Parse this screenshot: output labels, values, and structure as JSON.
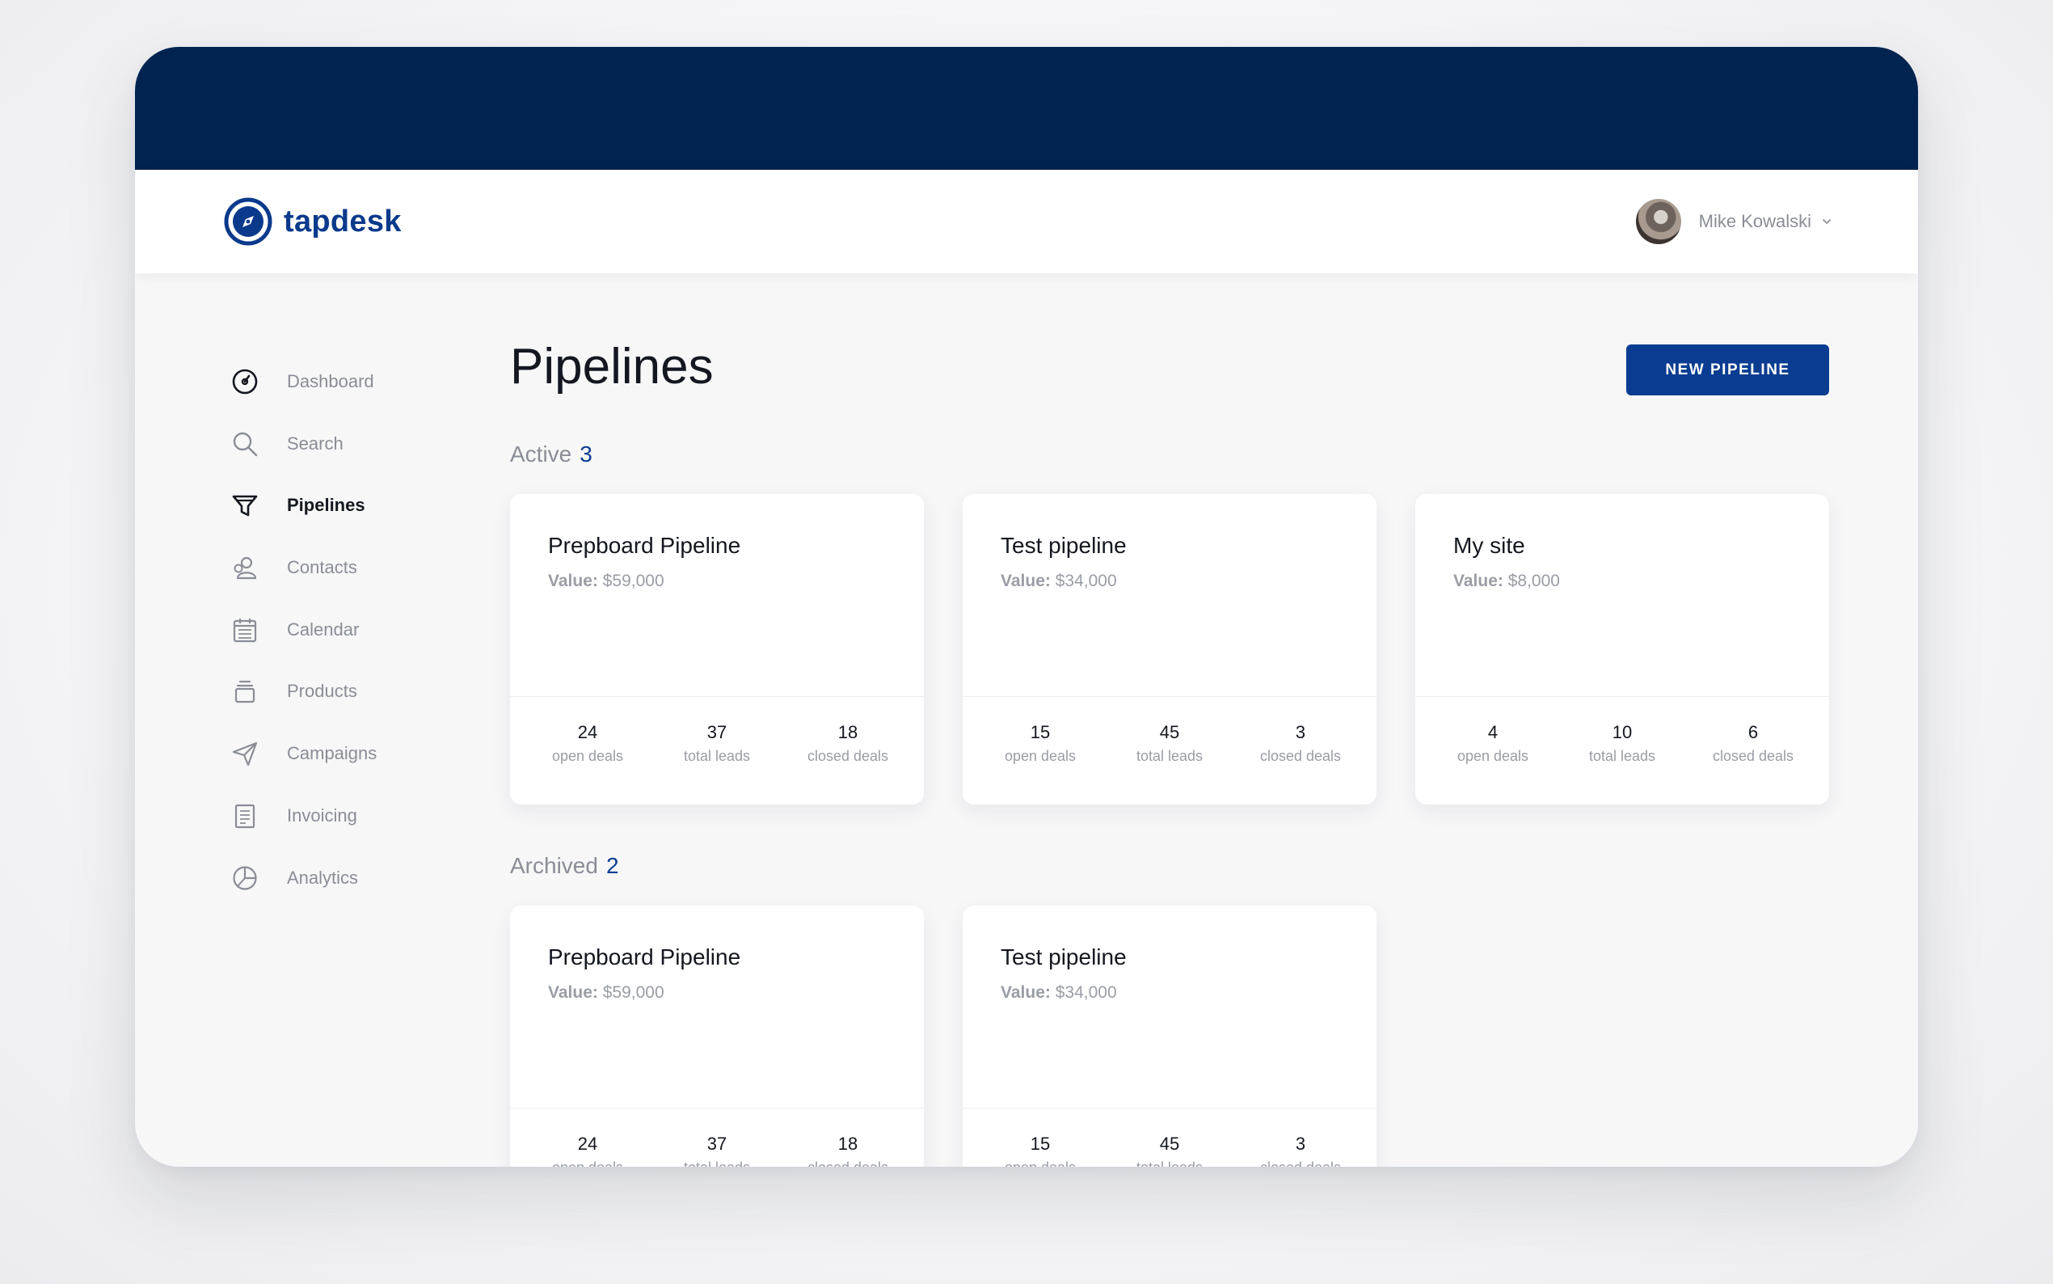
{
  "app": {
    "name": "tapdesk"
  },
  "user": {
    "name": "Mike Kowalski"
  },
  "nav": [
    {
      "label": "Dashboard",
      "icon": "dashboard-icon",
      "active": false
    },
    {
      "label": "Search",
      "icon": "search-icon",
      "active": false
    },
    {
      "label": "Pipelines",
      "icon": "funnel-icon",
      "active": true
    },
    {
      "label": "Contacts",
      "icon": "contacts-icon",
      "active": false
    },
    {
      "label": "Calendar",
      "icon": "calendar-icon",
      "active": false
    },
    {
      "label": "Products",
      "icon": "products-icon",
      "active": false
    },
    {
      "label": "Campaigns",
      "icon": "send-icon",
      "active": false
    },
    {
      "label": "Invoicing",
      "icon": "invoice-icon",
      "active": false
    },
    {
      "label": "Analytics",
      "icon": "analytics-icon",
      "active": false
    }
  ],
  "page": {
    "title": "Pipelines",
    "new_button": "NEW PIPELINE"
  },
  "value_prefix": "Value:",
  "stat_labels": {
    "open": "open deals",
    "total": "total leads",
    "closed": "closed deals"
  },
  "active": {
    "label": "Active",
    "count": "3",
    "cards": [
      {
        "title": "Prepboard Pipeline",
        "value": "$59,000",
        "open": "24",
        "total": "37",
        "closed": "18"
      },
      {
        "title": "Test pipeline",
        "value": "$34,000",
        "open": "15",
        "total": "45",
        "closed": "3"
      },
      {
        "title": "My site",
        "value": "$8,000",
        "open": "4",
        "total": "10",
        "closed": "6"
      }
    ]
  },
  "archived": {
    "label": "Archived",
    "count": "2",
    "cards": [
      {
        "title": "Prepboard Pipeline",
        "value": "$59,000",
        "open": "24",
        "total": "37",
        "closed": "18"
      },
      {
        "title": "Test pipeline",
        "value": "$34,000",
        "open": "15",
        "total": "45",
        "closed": "3"
      }
    ]
  },
  "colors": {
    "brand": "#0a3d91",
    "topband": "#00234f",
    "muted": "#8a8d96"
  }
}
